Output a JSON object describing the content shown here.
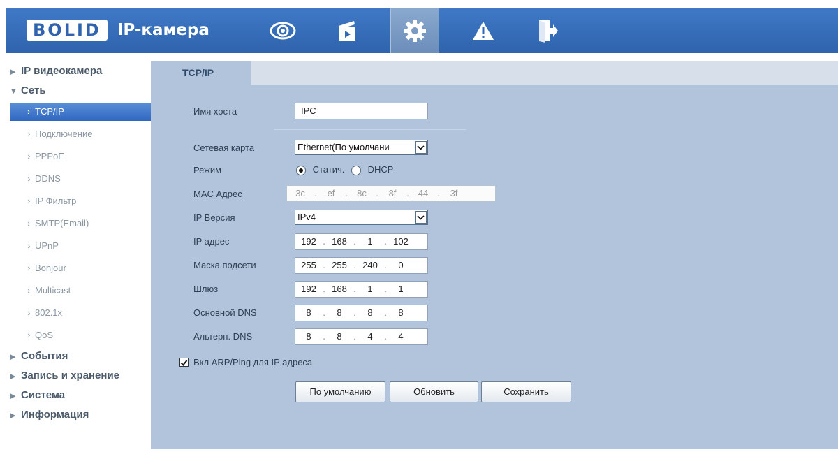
{
  "header": {
    "logo_badge": "BOLID",
    "logo_text": "IP-камера",
    "nav": [
      "live-view-icon",
      "playback-icon",
      "settings-icon",
      "alarm-icon",
      "logout-icon"
    ],
    "active_nav": "settings-icon"
  },
  "sidebar": {
    "sections": [
      {
        "label": "IP видеокамера",
        "expanded": false
      },
      {
        "label": "Сеть",
        "expanded": true
      },
      {
        "label": "События",
        "expanded": false
      },
      {
        "label": "Запись и хранение",
        "expanded": false
      },
      {
        "label": "Система",
        "expanded": false
      },
      {
        "label": "Информация",
        "expanded": false
      }
    ],
    "network_items": [
      "TCP/IP",
      "Подключение",
      "PPPoE",
      "DDNS",
      "IP Фильтр",
      "SMTP(Email)",
      "UPnP",
      "Bonjour",
      "Multicast",
      "802.1x",
      "QoS"
    ],
    "active_item": "TCP/IP"
  },
  "tab": {
    "label": "TCP/IP"
  },
  "form": {
    "hostname": {
      "label": "Имя хоста",
      "value": "IPC"
    },
    "nic": {
      "label": "Сетевая карта",
      "value": "Ethernet(По умолчани"
    },
    "mode": {
      "label": "Режим",
      "static": "Статич.",
      "dhcp": "DHCP",
      "selected": "static"
    },
    "mac": {
      "label": "MAC Адрес",
      "octets": [
        "3c",
        "ef",
        "8c",
        "8f",
        "44",
        "3f"
      ]
    },
    "ip_version": {
      "label": "IP Версия",
      "value": "IPv4"
    },
    "ip": {
      "label": "IP адрес",
      "octets": [
        "192",
        "168",
        "1",
        "102"
      ]
    },
    "mask": {
      "label": "Маска подсети",
      "octets": [
        "255",
        "255",
        "240",
        "0"
      ]
    },
    "gateway": {
      "label": "Шлюз",
      "octets": [
        "192",
        "168",
        "1",
        "1"
      ]
    },
    "dns1": {
      "label": "Основной DNS",
      "octets": [
        "8",
        "8",
        "8",
        "8"
      ]
    },
    "dns2": {
      "label": "Альтерн. DNS",
      "octets": [
        "8",
        "8",
        "4",
        "4"
      ]
    },
    "arp": {
      "label": "Вкл ARP/Ping для IP адреса",
      "checked": true
    }
  },
  "buttons": {
    "default": "По умолчанию",
    "refresh": "Обновить",
    "save": "Сохранить"
  },
  "colors": {
    "header": "#3068b8",
    "panel": "#b1c4dc",
    "active_item": "#3a72c8"
  }
}
